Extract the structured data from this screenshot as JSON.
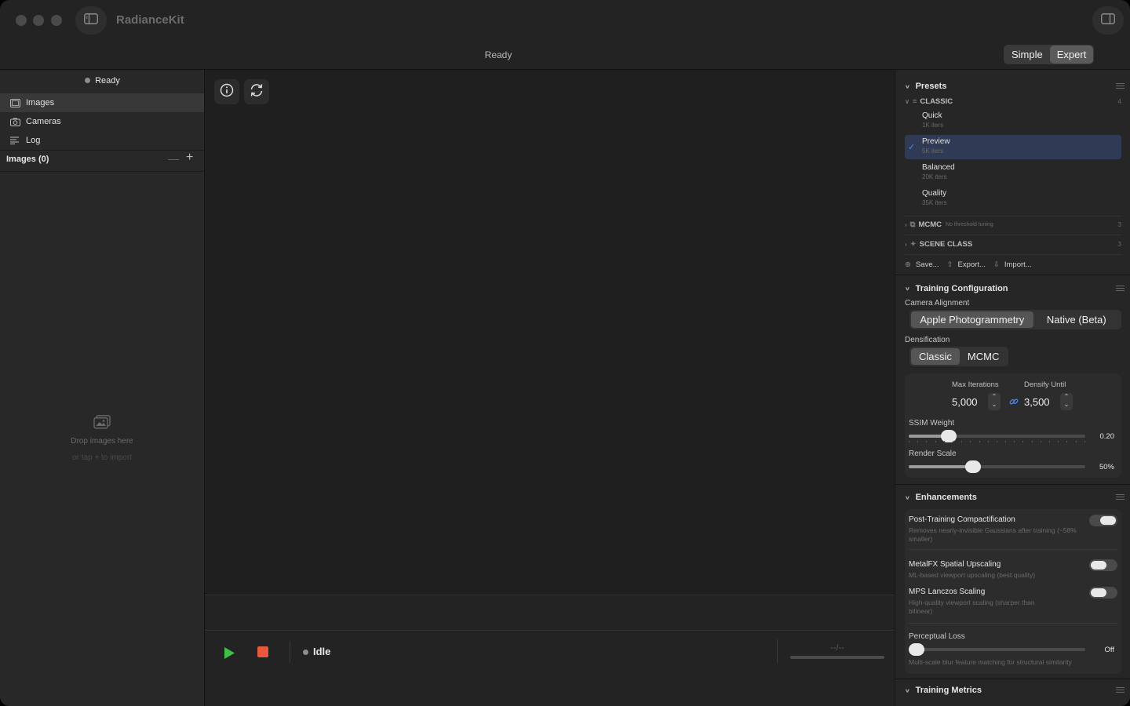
{
  "app": {
    "title": "RadianceKit",
    "status": "Ready",
    "mode_simple": "Simple",
    "mode_expert": "Expert",
    "active_mode": "Expert"
  },
  "sidebar": {
    "status": "Ready",
    "items": [
      {
        "label": "Images",
        "icon": "photo-icon",
        "active": true
      },
      {
        "label": "Cameras",
        "icon": "camera-icon",
        "active": false
      },
      {
        "label": "Log",
        "icon": "log-icon",
        "active": false
      }
    ],
    "images_header": "Images (0)",
    "minus_label": "—",
    "plus_label": "+",
    "drop_title": "Drop images here",
    "drop_subtitle": "or tap + to import"
  },
  "controls": {
    "state": "Idle",
    "eta": "--/--",
    "colors": {
      "play": "#3fbe48",
      "stop": "#e9573f"
    }
  },
  "presets": {
    "title": "Presets",
    "groups": [
      {
        "name": "CLASSIC",
        "count": "4",
        "expanded": true,
        "items": [
          {
            "name": "Quick",
            "iters": "1K iters",
            "selected": false
          },
          {
            "name": "Preview",
            "iters": "5K iters",
            "selected": true
          },
          {
            "name": "Balanced",
            "iters": "20K iters",
            "selected": false
          },
          {
            "name": "Quality",
            "iters": "35K iters",
            "selected": false
          }
        ]
      },
      {
        "name": "MCMC",
        "subtitle": "No threshold tuning",
        "count": "3",
        "expanded": false
      },
      {
        "name": "SCENE CLASS",
        "count": "3",
        "expanded": false
      }
    ],
    "actions": {
      "save": "Save...",
      "export": "Export...",
      "import": "Import..."
    }
  },
  "training": {
    "title": "Training Configuration",
    "camera_alignment_label": "Camera Alignment",
    "camera_alignment_options": [
      "Apple Photogrammetry",
      "Native (Beta)"
    ],
    "camera_alignment_selected": "Apple Photogrammetry",
    "densification_label": "Densification",
    "densification_options": [
      "Classic",
      "MCMC"
    ],
    "densification_selected": "Classic",
    "max_iterations_label": "Max Iterations",
    "max_iterations": "5,000",
    "densify_until_label": "Densify Until",
    "densify_until": "3,500",
    "ssim_label": "SSIM Weight",
    "ssim_value": "0.20",
    "ssim_fraction": 0.2,
    "render_scale_label": "Render Scale",
    "render_scale_value": "50%",
    "render_scale_fraction": 0.35
  },
  "enhancements": {
    "title": "Enhancements",
    "items": [
      {
        "title": "Post-Training Compactification",
        "desc": "Removes nearly-invisible Gaussians after training (~58% smaller)",
        "on": true
      },
      {
        "title": "MetalFX Spatial Upscaling",
        "desc": "ML-based viewport upscaling (best quality)",
        "on": false
      },
      {
        "title": "MPS Lanczos Scaling",
        "desc": "High-quality viewport scaling (sharper than bilinear)",
        "on": false
      }
    ],
    "perceptual_label": "Perceptual Loss",
    "perceptual_value": "Off",
    "perceptual_desc": "Multi-scale blur feature matching for structural similarity"
  },
  "metrics": {
    "title": "Training Metrics"
  }
}
